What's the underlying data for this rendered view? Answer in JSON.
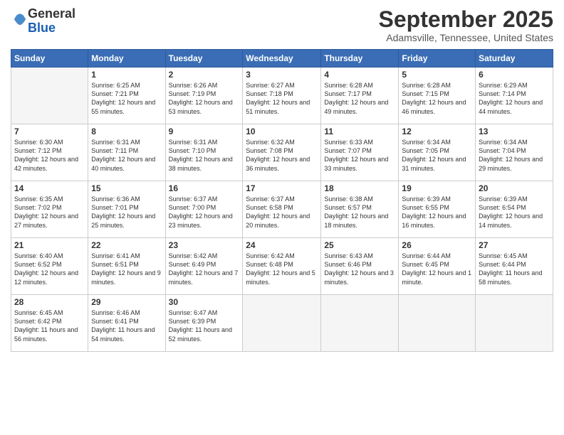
{
  "logo": {
    "general": "General",
    "blue": "Blue"
  },
  "header": {
    "month": "September 2025",
    "location": "Adamsville, Tennessee, United States"
  },
  "weekdays": [
    "Sunday",
    "Monday",
    "Tuesday",
    "Wednesday",
    "Thursday",
    "Friday",
    "Saturday"
  ],
  "weeks": [
    [
      {
        "day": null
      },
      {
        "day": 1,
        "sunrise": "6:25 AM",
        "sunset": "7:21 PM",
        "daylight": "12 hours and 55 minutes."
      },
      {
        "day": 2,
        "sunrise": "6:26 AM",
        "sunset": "7:19 PM",
        "daylight": "12 hours and 53 minutes."
      },
      {
        "day": 3,
        "sunrise": "6:27 AM",
        "sunset": "7:18 PM",
        "daylight": "12 hours and 51 minutes."
      },
      {
        "day": 4,
        "sunrise": "6:28 AM",
        "sunset": "7:17 PM",
        "daylight": "12 hours and 49 minutes."
      },
      {
        "day": 5,
        "sunrise": "6:28 AM",
        "sunset": "7:15 PM",
        "daylight": "12 hours and 46 minutes."
      },
      {
        "day": 6,
        "sunrise": "6:29 AM",
        "sunset": "7:14 PM",
        "daylight": "12 hours and 44 minutes."
      }
    ],
    [
      {
        "day": 7,
        "sunrise": "6:30 AM",
        "sunset": "7:12 PM",
        "daylight": "12 hours and 42 minutes."
      },
      {
        "day": 8,
        "sunrise": "6:31 AM",
        "sunset": "7:11 PM",
        "daylight": "12 hours and 40 minutes."
      },
      {
        "day": 9,
        "sunrise": "6:31 AM",
        "sunset": "7:10 PM",
        "daylight": "12 hours and 38 minutes."
      },
      {
        "day": 10,
        "sunrise": "6:32 AM",
        "sunset": "7:08 PM",
        "daylight": "12 hours and 36 minutes."
      },
      {
        "day": 11,
        "sunrise": "6:33 AM",
        "sunset": "7:07 PM",
        "daylight": "12 hours and 33 minutes."
      },
      {
        "day": 12,
        "sunrise": "6:34 AM",
        "sunset": "7:05 PM",
        "daylight": "12 hours and 31 minutes."
      },
      {
        "day": 13,
        "sunrise": "6:34 AM",
        "sunset": "7:04 PM",
        "daylight": "12 hours and 29 minutes."
      }
    ],
    [
      {
        "day": 14,
        "sunrise": "6:35 AM",
        "sunset": "7:02 PM",
        "daylight": "12 hours and 27 minutes."
      },
      {
        "day": 15,
        "sunrise": "6:36 AM",
        "sunset": "7:01 PM",
        "daylight": "12 hours and 25 minutes."
      },
      {
        "day": 16,
        "sunrise": "6:37 AM",
        "sunset": "7:00 PM",
        "daylight": "12 hours and 23 minutes."
      },
      {
        "day": 17,
        "sunrise": "6:37 AM",
        "sunset": "6:58 PM",
        "daylight": "12 hours and 20 minutes."
      },
      {
        "day": 18,
        "sunrise": "6:38 AM",
        "sunset": "6:57 PM",
        "daylight": "12 hours and 18 minutes."
      },
      {
        "day": 19,
        "sunrise": "6:39 AM",
        "sunset": "6:55 PM",
        "daylight": "12 hours and 16 minutes."
      },
      {
        "day": 20,
        "sunrise": "6:39 AM",
        "sunset": "6:54 PM",
        "daylight": "12 hours and 14 minutes."
      }
    ],
    [
      {
        "day": 21,
        "sunrise": "6:40 AM",
        "sunset": "6:52 PM",
        "daylight": "12 hours and 12 minutes."
      },
      {
        "day": 22,
        "sunrise": "6:41 AM",
        "sunset": "6:51 PM",
        "daylight": "12 hours and 9 minutes."
      },
      {
        "day": 23,
        "sunrise": "6:42 AM",
        "sunset": "6:49 PM",
        "daylight": "12 hours and 7 minutes."
      },
      {
        "day": 24,
        "sunrise": "6:42 AM",
        "sunset": "6:48 PM",
        "daylight": "12 hours and 5 minutes."
      },
      {
        "day": 25,
        "sunrise": "6:43 AM",
        "sunset": "6:46 PM",
        "daylight": "12 hours and 3 minutes."
      },
      {
        "day": 26,
        "sunrise": "6:44 AM",
        "sunset": "6:45 PM",
        "daylight": "12 hours and 1 minute."
      },
      {
        "day": 27,
        "sunrise": "6:45 AM",
        "sunset": "6:44 PM",
        "daylight": "11 hours and 58 minutes."
      }
    ],
    [
      {
        "day": 28,
        "sunrise": "6:45 AM",
        "sunset": "6:42 PM",
        "daylight": "11 hours and 56 minutes."
      },
      {
        "day": 29,
        "sunrise": "6:46 AM",
        "sunset": "6:41 PM",
        "daylight": "11 hours and 54 minutes."
      },
      {
        "day": 30,
        "sunrise": "6:47 AM",
        "sunset": "6:39 PM",
        "daylight": "11 hours and 52 minutes."
      },
      {
        "day": null
      },
      {
        "day": null
      },
      {
        "day": null
      },
      {
        "day": null
      }
    ]
  ]
}
